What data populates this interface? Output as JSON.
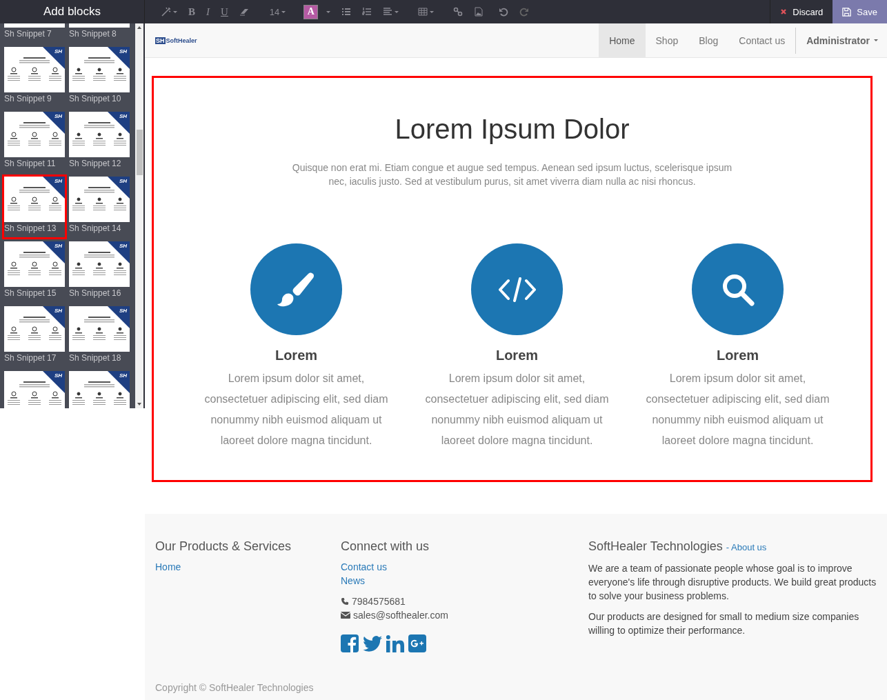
{
  "sidebar": {
    "title": "Add blocks",
    "snippets": [
      {
        "label": "Sh Snippet 7",
        "selected": false
      },
      {
        "label": "Sh Snippet 8",
        "selected": false
      },
      {
        "label": "Sh Snippet 9",
        "badge": "SH",
        "selected": false
      },
      {
        "label": "Sh Snippet 10",
        "badge": "SH",
        "selected": false
      },
      {
        "label": "Sh Snippet 11",
        "badge": "SH",
        "selected": false
      },
      {
        "label": "Sh Snippet 12",
        "badge": "SH",
        "selected": false
      },
      {
        "label": "Sh Snippet 13",
        "badge": "SH",
        "selected": true
      },
      {
        "label": "Sh Snippet 14",
        "badge": "SH",
        "selected": false
      },
      {
        "label": "Sh Snippet 15",
        "badge": "SH",
        "selected": false
      },
      {
        "label": "Sh Snippet 16",
        "badge": "SH",
        "selected": false
      },
      {
        "label": "Sh Snippet 17",
        "badge": "SH",
        "selected": false
      },
      {
        "label": "Sh Snippet 18",
        "badge": "SH",
        "selected": false
      },
      {
        "badge": "SH",
        "selected": false
      },
      {
        "badge": "SH",
        "selected": false
      }
    ]
  },
  "toolbar": {
    "bold": "B",
    "italic": "I",
    "underline": "U",
    "font_size": "14",
    "color_button": "A",
    "actions": [
      {
        "label": "Discard",
        "kind": "discard"
      },
      {
        "label": "Save",
        "kind": "save"
      }
    ]
  },
  "navbar": {
    "logo_mark": "SH",
    "logo_text": "SoftHealer",
    "items": [
      {
        "label": "Home",
        "selected": true
      },
      {
        "label": "Shop",
        "selected": false
      },
      {
        "label": "Blog",
        "selected": false
      },
      {
        "label": "Contact us",
        "selected": false
      }
    ],
    "user": "Administrator"
  },
  "hero": {
    "title": "Lorem Ipsum Dolor",
    "subtitle": "Quisque non erat mi. Etiam congue et augue sed tempus. Aenean sed ipsum luctus, scelerisque ipsum nec, iaculis justo. Sed at vestibulum purus, sit amet viverra diam nulla ac nisi rhoncus.",
    "features": [
      {
        "kind": "brush",
        "title": "Lorem",
        "text": "Lorem ipsum dolor sit amet, consectetuer adipiscing elit, sed diam nonummy nibh euismod aliquam ut laoreet dolore magna tincidunt."
      },
      {
        "kind": "code",
        "title": "Lorem",
        "text": "Lorem ipsum dolor sit amet, consectetuer adipiscing elit, sed diam nonummy nibh euismod aliquam ut laoreet dolore magna tincidunt."
      },
      {
        "kind": "search",
        "title": "Lorem",
        "text": "Lorem ipsum dolor sit amet, consectetuer adipiscing elit, sed diam nonummy nibh euismod aliquam ut laoreet dolore magna tincidunt."
      }
    ]
  },
  "footer": {
    "products": {
      "title": "Our Products & Services",
      "links": [
        "Home"
      ]
    },
    "connect": {
      "title": "Connect with us",
      "links": [
        "Contact us",
        "News"
      ],
      "phone": "7984575681",
      "email": "sales@softhealer.com"
    },
    "about": {
      "title": "SoftHealer Technologies",
      "link": "- About us",
      "paragraphs": [
        "We are a team of passionate people whose goal is to improve everyone's life through disruptive products. We build great products to solve your business problems.",
        "Our products are designed for small to medium size companies willing to optimize their performance."
      ]
    },
    "copyright": "Copyright © SoftHealer Technologies"
  }
}
